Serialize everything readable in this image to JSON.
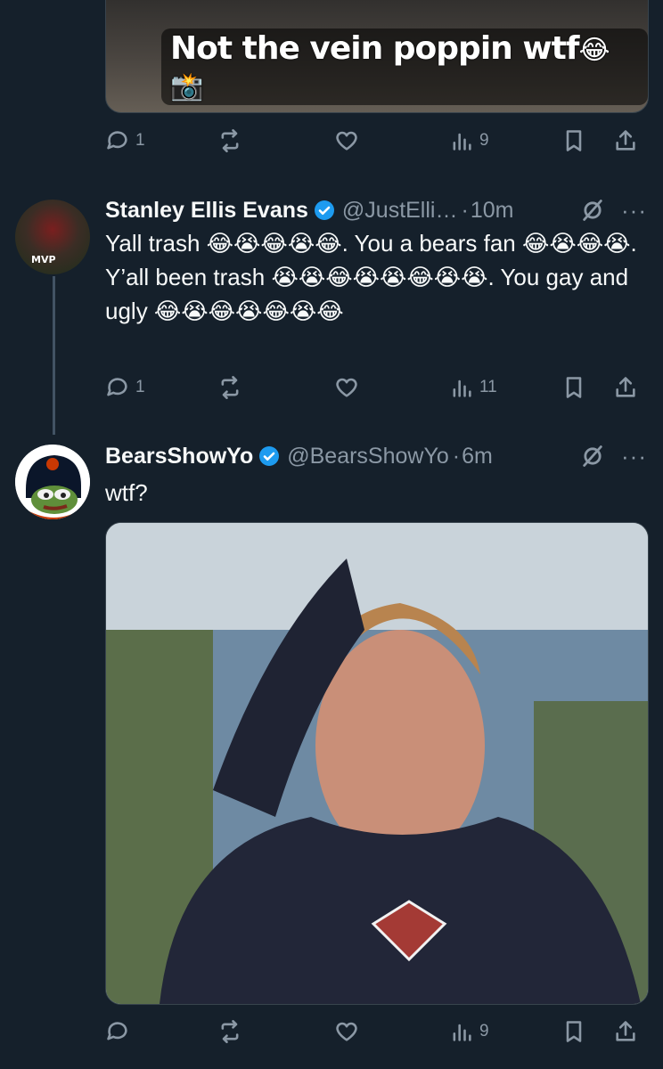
{
  "top_tweet": {
    "media_caption": "Not the vein poppin wtf",
    "media_caption_emoji": "😂📸",
    "stats": {
      "replies": "1",
      "retweets": "",
      "likes": "",
      "views": "9"
    }
  },
  "reply_1": {
    "display_name": "Stanley Ellis Evans",
    "handle": "@JustElli…",
    "separator": "·",
    "time": "10m",
    "avatar_label": "MVP",
    "text": "Yall trash 😂😭😂😭😂. You a bears fan 😂😭😂😭. Y’all been trash 😭😭😂😭😭😂😭😭. You gay and ugly 😂😭😂😭😂😭😂",
    "stats": {
      "replies": "1",
      "retweets": "",
      "likes": "",
      "views": "11"
    }
  },
  "reply_2": {
    "display_name": "BearsShowYo",
    "handle": "@BearsShowYo",
    "separator": "·",
    "time": "6m",
    "text": "wtf?",
    "stats": {
      "replies": "",
      "retweets": "",
      "likes": "",
      "views": "9"
    }
  },
  "more_label": "···",
  "colors": {
    "background": "#15202b",
    "text": "#f7f9f9",
    "secondary": "#8b98a5",
    "verified": "#1d9bf0",
    "thread_line": "#425364"
  }
}
